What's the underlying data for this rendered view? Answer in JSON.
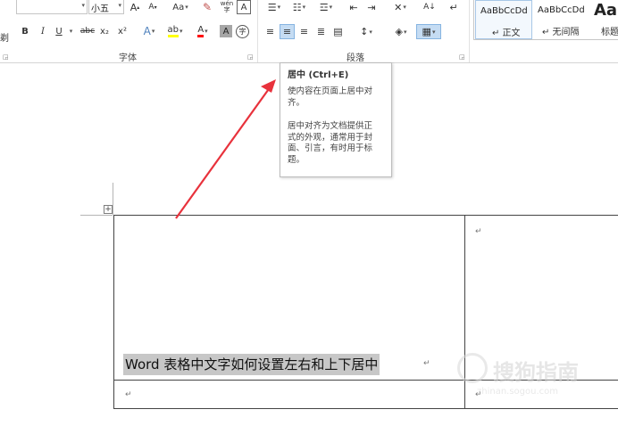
{
  "ribbon": {
    "edge_char": "剃",
    "font_group": {
      "label": "字体",
      "font_size": "小五",
      "grow_font_label": "A",
      "shrink_font_label": "A",
      "change_case_label": "Aa",
      "phonetic_guide_label": "wén",
      "bold_label": "B",
      "italic_label": "I",
      "underline_label": "U",
      "strikethrough_label": "abc",
      "subscript_label": "x₂",
      "superscript_label": "x²",
      "text_effects_label": "A",
      "highlight_label": "ab",
      "font_color_label": "A",
      "char_shading_label": "A",
      "enclose_char_label": "字"
    },
    "paragraph_group": {
      "label": "段落",
      "sort_label": "A↓"
    },
    "styles_group": {
      "styles": [
        {
          "preview": "AaBbCcDd",
          "name": "↵ 正文"
        },
        {
          "preview": "AaBbCcDd",
          "name": "↵ 无间隔"
        },
        {
          "preview": "Aa",
          "name": "标题"
        }
      ]
    }
  },
  "tooltip": {
    "title": "居中 (Ctrl+E)",
    "desc_lines": [
      "使内容在页面上居中对",
      "齐。"
    ],
    "detail_lines": [
      "居中对齐为文档提供正",
      "式的外观，通常用于封",
      "面、引言，有时用于标",
      "题。"
    ]
  },
  "document": {
    "table_handle": "+",
    "cell_text": "Word 表格中文字如何设置左右和上下居中",
    "paragraph_mark": "↵"
  },
  "watermark": {
    "text": "搜狗指南",
    "subtext": "zhinan.sogou.com"
  },
  "colors": {
    "arrow": "#e8323c",
    "selection_highlight": "#c7c7c7",
    "active_button": "#c5dcf3"
  }
}
